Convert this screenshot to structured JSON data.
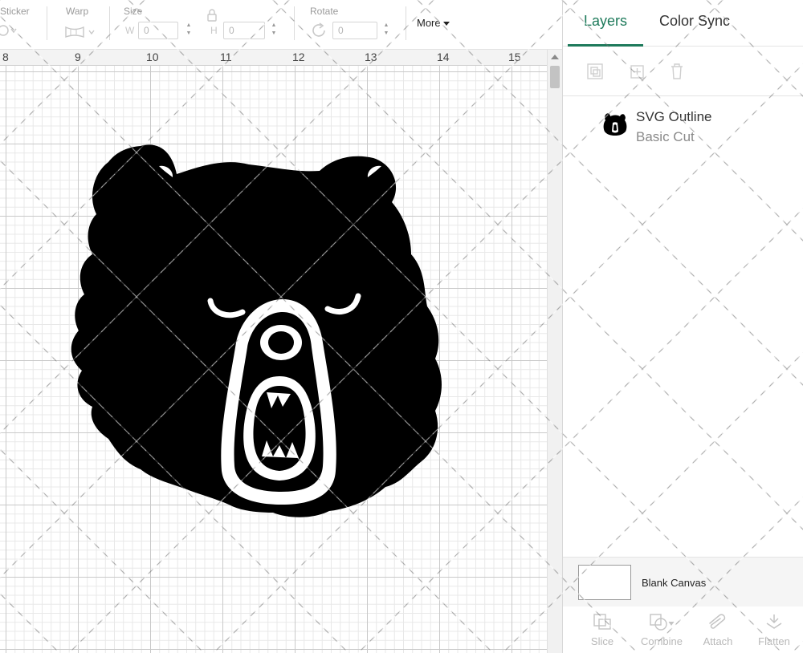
{
  "toolbar": {
    "sticker_label": "Sticker",
    "warp_label": "Warp",
    "size_label": "Size",
    "width_prefix": "W",
    "width_value": "0",
    "height_prefix": "H",
    "height_value": "0",
    "rotate_label": "Rotate",
    "rotate_value": "0",
    "more_label": "More"
  },
  "ruler": {
    "labels": [
      "8",
      "9",
      "10",
      "11",
      "12",
      "13",
      "14",
      "15"
    ]
  },
  "canvas": {
    "object_name": "bear-head-design"
  },
  "panel": {
    "tabs": {
      "layers": "Layers",
      "color_sync": "Color Sync"
    },
    "layer": {
      "name": "SVG Outline",
      "operation": "Basic Cut"
    },
    "blank_canvas_label": "Blank Canvas",
    "bottom_actions": {
      "slice": "Slice",
      "combine": "Combine",
      "attach": "Attach",
      "flatten": "Flatten"
    }
  },
  "colors": {
    "accent": "#1e7a5b",
    "design_fill": "#000000",
    "grid_major": "#c9c9c9",
    "grid_minor": "#e8e8e8"
  }
}
